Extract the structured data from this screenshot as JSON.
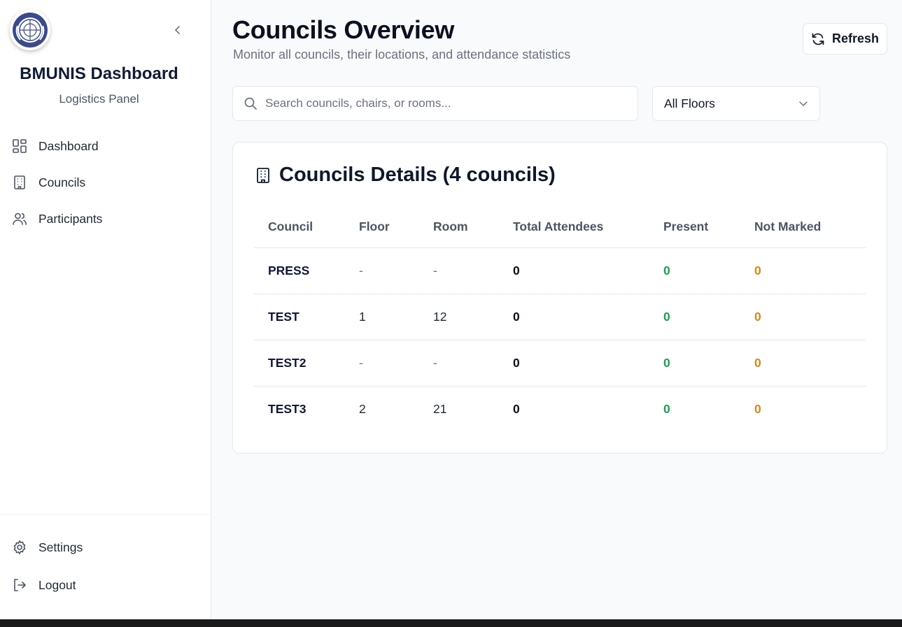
{
  "brand": {
    "title": "BMUNIS Dashboard",
    "subtitle": "Logistics Panel",
    "logo_icon": "un-emblem-icon"
  },
  "sidebar": {
    "items": [
      {
        "label": "Dashboard",
        "icon": "dashboard-icon"
      },
      {
        "label": "Councils",
        "icon": "building-icon"
      },
      {
        "label": "Participants",
        "icon": "users-icon"
      }
    ],
    "bottom": [
      {
        "label": "Settings",
        "icon": "gear-icon"
      },
      {
        "label": "Logout",
        "icon": "logout-icon"
      }
    ]
  },
  "header": {
    "title": "Councils Overview",
    "subtitle": "Monitor all councils, their locations, and attendance statistics",
    "refresh_label": "Refresh"
  },
  "filters": {
    "search_placeholder": "Search councils, chairs, or rooms...",
    "search_value": "",
    "floor_selected": "All Floors"
  },
  "table": {
    "title": "Councils Details (4 councils)",
    "columns": [
      "Council",
      "Floor",
      "Room",
      "Total Attendees",
      "Present",
      "Not Marked"
    ],
    "rows": [
      {
        "council": "PRESS",
        "floor": "-",
        "room": "-",
        "total": "0",
        "present": "0",
        "not_marked": "0"
      },
      {
        "council": "TEST",
        "floor": "1",
        "room": "12",
        "total": "0",
        "present": "0",
        "not_marked": "0"
      },
      {
        "council": "TEST2",
        "floor": "-",
        "room": "-",
        "total": "0",
        "present": "0",
        "not_marked": "0"
      },
      {
        "council": "TEST3",
        "floor": "2",
        "room": "21",
        "total": "0",
        "present": "0",
        "not_marked": "0"
      }
    ]
  },
  "colors": {
    "present": "#16a34a",
    "not_marked": "#d08a1e",
    "brand": "#111a36"
  }
}
